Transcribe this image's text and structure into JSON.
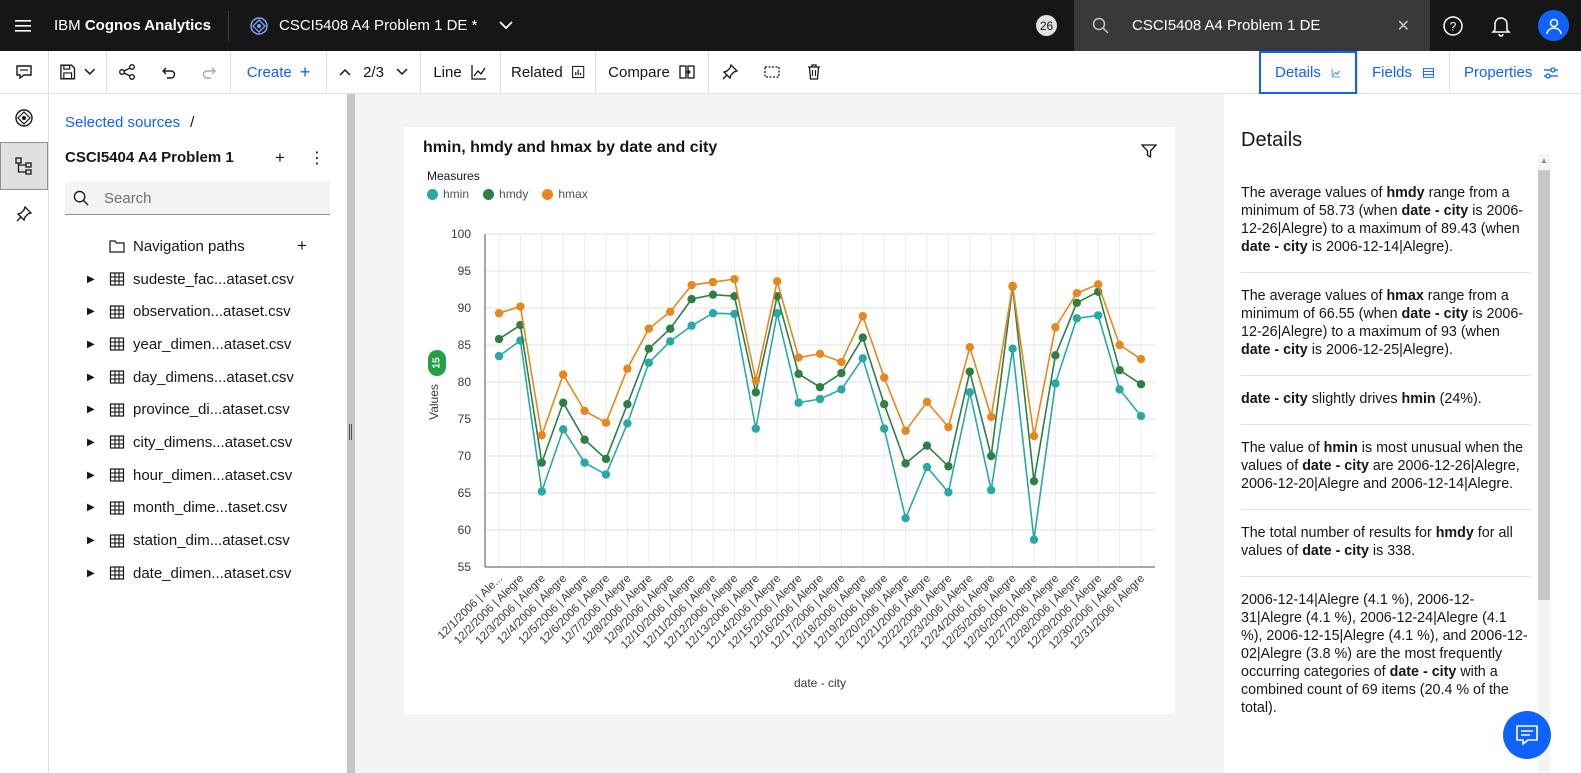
{
  "topbar": {
    "brand_prefix": "IBM ",
    "brand_name": "Cognos Analytics",
    "report_title": "CSCI5408 A4 Problem 1 DE *",
    "notification_count": "26",
    "search_value": "CSCI5408 A4 Problem 1 DE"
  },
  "toolbar": {
    "create_label": "Create",
    "page_indicator": "2/3",
    "line_label": "Line",
    "related_label": "Related",
    "compare_label": "Compare",
    "details_tab": "Details",
    "fields_tab": "Fields",
    "properties_tab": "Properties"
  },
  "sources": {
    "breadcrumb": "Selected sources",
    "breadcrumb_sep": "/",
    "source_name": "CSCI5404 A4 Problem 1",
    "search_placeholder": "Search",
    "nav_paths": "Navigation paths",
    "items": [
      "sudeste_fac...ataset.csv",
      "observation...ataset.csv",
      "year_dimen...ataset.csv",
      "day_dimens...ataset.csv",
      "province_di...ataset.csv",
      "city_dimens...ataset.csv",
      "hour_dimen...ataset.csv",
      "month_dime...taset.csv",
      "station_dim...ataset.csv",
      "date_dimen...ataset.csv"
    ]
  },
  "card": {
    "title": "hmin, hmdy and hmax by date and city",
    "legend_title": "Measures",
    "badge": "15"
  },
  "chart_data": {
    "type": "line",
    "title": "hmin, hmdy and hmax by date and city",
    "xlabel": "date - city",
    "ylabel": "Values",
    "ylim": [
      55,
      100
    ],
    "yticks": [
      55,
      60,
      65,
      70,
      75,
      80,
      85,
      90,
      95,
      100
    ],
    "grid": true,
    "legend_position": "top-left",
    "categories": [
      "12/1/2006 | Ale...",
      "12/2/2006 | Alegre",
      "12/3/2006 | Alegre",
      "12/4/2006 | Alegre",
      "12/5/2006 | Alegre",
      "12/6/2006 | Alegre",
      "12/7/2006 | Alegre",
      "12/8/2006 | Alegre",
      "12/9/2006 | Alegre",
      "12/10/2006 | Alegre",
      "12/11/2006 | Alegre",
      "12/12/2006 | Alegre",
      "12/13/2006 | Alegre",
      "12/14/2006 | Alegre",
      "12/15/2006 | Alegre",
      "12/16/2006 | Alegre",
      "12/17/2006 | Alegre",
      "12/18/2006 | Alegre",
      "12/19/2006 | Alegre",
      "12/20/2006 | Alegre",
      "12/21/2006 | Alegre",
      "12/22/2006 | Alegre",
      "12/23/2006 | Alegre",
      "12/24/2006 | Alegre",
      "12/25/2006 | Alegre",
      "12/26/2006 | Alegre",
      "12/27/2006 | Alegre",
      "12/28/2006 | Alegre",
      "12/29/2006 | Alegre",
      "12/30/2006 | Alegre",
      "12/31/2006 | Alegre"
    ],
    "series": [
      {
        "name": "hmin",
        "color": "#2aa8a8",
        "values": [
          83.5,
          85.6,
          65.2,
          73.6,
          69.1,
          67.5,
          74.4,
          82.6,
          85.5,
          87.6,
          89.3,
          89.2,
          73.7,
          89.3,
          77.2,
          77.7,
          79.0,
          83.2,
          73.7,
          61.6,
          68.5,
          65.1,
          78.6,
          65.4,
          84.5,
          58.7,
          79.8,
          88.6,
          89.0,
          79.0,
          75.4
        ]
      },
      {
        "name": "hmdy",
        "color": "#2f7f45",
        "values": [
          85.8,
          87.7,
          69.1,
          77.2,
          72.2,
          69.6,
          77.0,
          84.5,
          87.2,
          91.2,
          91.8,
          91.6,
          78.6,
          91.6,
          81.1,
          79.3,
          81.2,
          86.0,
          77.0,
          69.0,
          71.4,
          68.6,
          81.4,
          70.0,
          92.9,
          66.6,
          83.6,
          90.7,
          92.2,
          81.6,
          79.7
        ]
      },
      {
        "name": "hmax",
        "color": "#e8871e",
        "values": [
          89.3,
          90.2,
          72.8,
          81.0,
          76.1,
          74.5,
          81.8,
          87.2,
          89.5,
          93.1,
          93.5,
          93.9,
          80.2,
          93.6,
          83.3,
          83.8,
          82.7,
          88.9,
          80.6,
          73.4,
          77.3,
          73.9,
          84.7,
          75.3,
          93.0,
          72.7,
          87.4,
          92.0,
          93.2,
          85.0,
          83.1
        ]
      }
    ]
  },
  "details": {
    "heading": "Details",
    "blocks": [
      {
        "pre": "The average values of ",
        "b1": "hmdy",
        "mid1": " range from a minimum of 58.73 (when ",
        "b2": "date - city",
        "mid2": " is 2006-12-26|Alegre) to a maximum of 89.43 (when ",
        "b3": "date - city",
        "post": " is 2006-12-14|Alegre)."
      },
      {
        "pre": "The average values of ",
        "b1": "hmax",
        "mid1": " range from a minimum of 66.55 (when ",
        "b2": "date - city",
        "mid2": " is 2006-12-26|Alegre) to a maximum of 93 (when ",
        "b3": "date - city",
        "post": " is 2006-12-25|Alegre)."
      },
      {
        "b0": "date - city",
        "pre": " slightly drives ",
        "b1": "hmin",
        "post": " (24%)."
      },
      {
        "pre": "The value of ",
        "b1": "hmin",
        "mid1": " is most unusual when the values of ",
        "b2": "date - city",
        "post": " are 2006-12-26|Alegre, 2006-12-20|Alegre and 2006-12-14|Alegre."
      },
      {
        "pre": "The total number of results for ",
        "b1": "hmdy",
        "mid1": " for all values of ",
        "b2": "date - city",
        "post": " is 338."
      },
      {
        "pre": "2006-12-14|Alegre (4.1 %), 2006-12-31|Alegre (4.1 %), 2006-12-24|Alegre (4.1 %), 2006-12-15|Alegre (4.1 %), and 2006-12-02|Alegre (3.8 %) are the most frequently occurring categories of ",
        "b1": "date - city",
        "post": " with a combined count of 69 items (20.4 % of the total)."
      }
    ]
  }
}
